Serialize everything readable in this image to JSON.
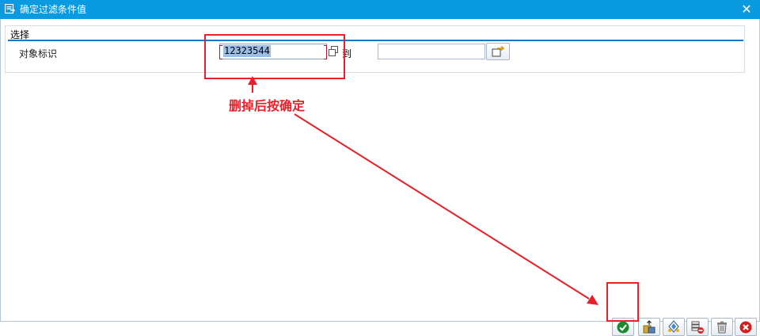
{
  "window": {
    "title": "确定过滤条件值",
    "close_glyph": "✕"
  },
  "selection": {
    "group_title": "选择",
    "field_label": "对象标识",
    "from_value": "12323544",
    "to_label": "到",
    "to_value": ""
  },
  "annotation": {
    "text": "删掉后按确定",
    "color": "#e8202a"
  },
  "toolbar": {
    "buttons": [
      {
        "name": "confirm-button",
        "icon": "check-icon"
      },
      {
        "name": "upload-button",
        "icon": "upload-icon"
      },
      {
        "name": "diamond-button",
        "icon": "diamond-icon"
      },
      {
        "name": "delete-row-button",
        "icon": "delete-row-icon"
      },
      {
        "name": "trash-button",
        "icon": "trash-icon"
      },
      {
        "name": "cancel-button",
        "icon": "cancel-icon"
      }
    ]
  },
  "colors": {
    "titlebar": "#0a9ae0",
    "accent_line": "#1a78c8",
    "selection_bg": "#9cbde6"
  }
}
